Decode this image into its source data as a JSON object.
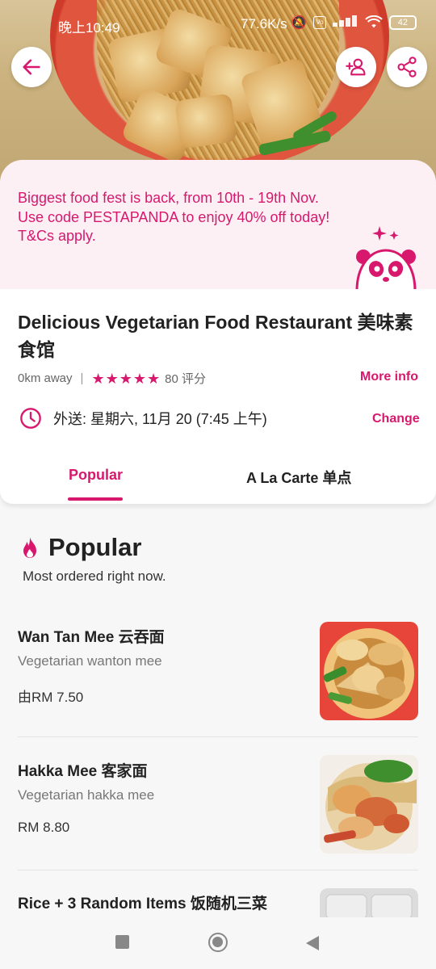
{
  "status_bar": {
    "time": "晚上10:49",
    "network_speed": "77.6K/s",
    "battery": "42",
    "icons": [
      "mute-icon",
      "volte-icon",
      "signal-icon",
      "wifi-icon",
      "battery-icon"
    ]
  },
  "header": {
    "back_icon": "arrow-left-icon",
    "group_order_icon": "add-person-icon",
    "share_icon": "share-icon"
  },
  "promo": {
    "text": "Biggest food fest is back, from 10th - 19th Nov. Use code PESTAPANDA to enjoy 40% off today! T&Cs apply."
  },
  "restaurant": {
    "name": "Delicious Vegetarian Food Restaurant 美味素食馆",
    "distance": "0km away",
    "rating_stars": 5,
    "ratings_count": "80 评分",
    "more_info": "More info",
    "delivery_text": "外送: 星期六, 11月 20 (7:45 上午)",
    "change": "Change"
  },
  "tabs": [
    {
      "label": "Popular",
      "active": true
    },
    {
      "label": "A La Carte 单点",
      "active": false
    }
  ],
  "popular_section": {
    "title": "Popular",
    "subtitle": "Most ordered right now."
  },
  "dishes": [
    {
      "name": "Wan Tan Mee 云吞面",
      "desc": "Vegetarian wanton mee",
      "price": "由RM 7.50"
    },
    {
      "name": "Hakka Mee 客家面",
      "desc": "Vegetarian hakka mee",
      "price": "RM 8.80"
    },
    {
      "name": "Rice + 3 Random Items 饭随机三菜",
      "desc": "",
      "price": ""
    }
  ],
  "colors": {
    "brand": "#d7186d",
    "promo_bg": "#fdf0f5"
  }
}
